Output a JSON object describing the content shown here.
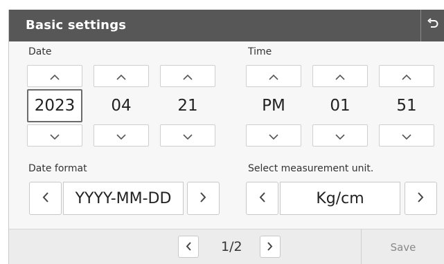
{
  "header": {
    "title": "Basic settings",
    "back_icon": "undo-arrow-icon"
  },
  "date": {
    "label": "Date",
    "year": "2023",
    "month": "04",
    "day": "21"
  },
  "time": {
    "label": "Time",
    "ampm": "PM",
    "hour": "01",
    "minute": "51"
  },
  "date_format": {
    "label": "Date format",
    "value": "YYYY-MM-DD"
  },
  "unit": {
    "label": "Select measurement unit.",
    "value": "Kg/cm"
  },
  "footer": {
    "page": "1/2",
    "save_label": "Save"
  },
  "colors": {
    "header_bg": "#575757",
    "panel_bg": "#f7f7f7",
    "footer_bg": "#ececec",
    "save_text": "#888888"
  }
}
